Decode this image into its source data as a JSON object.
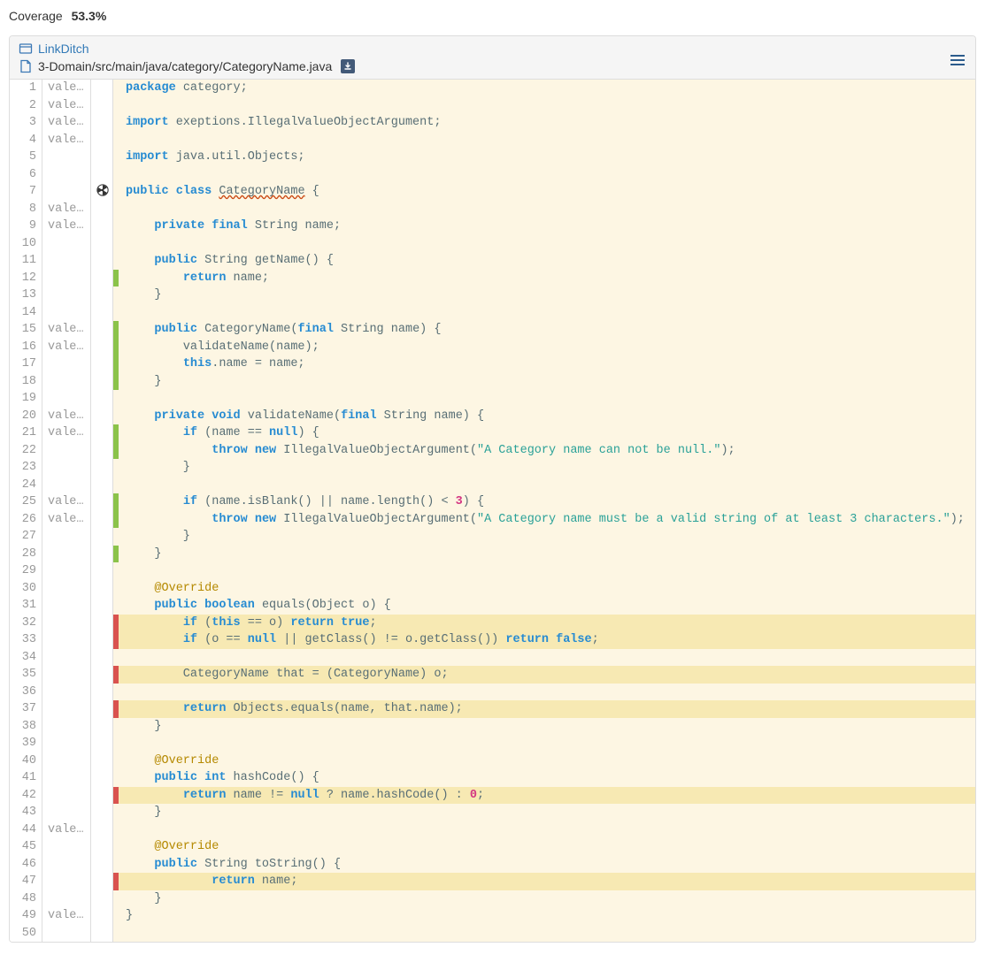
{
  "header": {
    "coverage_label": "Coverage",
    "coverage_value": "53.3%"
  },
  "breadcrumb": {
    "project_link": "LinkDitch",
    "file_path": "3-Domain/src/main/java/category/CategoryName.java"
  },
  "blame_text": "vale…",
  "lines": [
    {
      "n": 1,
      "blame": true,
      "icon": "",
      "cov": "none",
      "hl": false,
      "tokens": [
        [
          "kw",
          "package"
        ],
        [
          "plain",
          " category;"
        ]
      ]
    },
    {
      "n": 2,
      "blame": true,
      "icon": "",
      "cov": "none",
      "hl": false,
      "tokens": []
    },
    {
      "n": 3,
      "blame": true,
      "icon": "",
      "cov": "none",
      "hl": false,
      "tokens": [
        [
          "kw",
          "import"
        ],
        [
          "plain",
          " exeptions.IllegalValueObjectArgument;"
        ]
      ]
    },
    {
      "n": 4,
      "blame": true,
      "icon": "",
      "cov": "none",
      "hl": false,
      "tokens": []
    },
    {
      "n": 5,
      "blame": false,
      "icon": "",
      "cov": "none",
      "hl": false,
      "tokens": [
        [
          "kw",
          "import"
        ],
        [
          "plain",
          " java.util.Objects;"
        ]
      ]
    },
    {
      "n": 6,
      "blame": false,
      "icon": "",
      "cov": "none",
      "hl": false,
      "tokens": []
    },
    {
      "n": 7,
      "blame": false,
      "icon": "radiation",
      "cov": "none",
      "hl": false,
      "tokens": [
        [
          "kw",
          "public"
        ],
        [
          "plain",
          " "
        ],
        [
          "kw",
          "class"
        ],
        [
          "plain",
          " "
        ],
        [
          "def",
          "CategoryName"
        ],
        [
          "plain",
          " {"
        ]
      ]
    },
    {
      "n": 8,
      "blame": true,
      "icon": "",
      "cov": "none",
      "hl": false,
      "tokens": []
    },
    {
      "n": 9,
      "blame": true,
      "icon": "",
      "cov": "none",
      "hl": false,
      "tokens": [
        [
          "plain",
          "    "
        ],
        [
          "kw",
          "private"
        ],
        [
          "plain",
          " "
        ],
        [
          "kw",
          "final"
        ],
        [
          "plain",
          " String name;"
        ]
      ]
    },
    {
      "n": 10,
      "blame": false,
      "icon": "",
      "cov": "none",
      "hl": false,
      "tokens": []
    },
    {
      "n": 11,
      "blame": false,
      "icon": "",
      "cov": "none",
      "hl": false,
      "tokens": [
        [
          "plain",
          "    "
        ],
        [
          "kw",
          "public"
        ],
        [
          "plain",
          " String getName() {"
        ]
      ]
    },
    {
      "n": 12,
      "blame": false,
      "icon": "",
      "cov": "green",
      "hl": false,
      "tokens": [
        [
          "plain",
          "        "
        ],
        [
          "kw",
          "return"
        ],
        [
          "plain",
          " name;"
        ]
      ]
    },
    {
      "n": 13,
      "blame": false,
      "icon": "",
      "cov": "none",
      "hl": false,
      "tokens": [
        [
          "plain",
          "    }"
        ]
      ]
    },
    {
      "n": 14,
      "blame": false,
      "icon": "",
      "cov": "none",
      "hl": false,
      "tokens": []
    },
    {
      "n": 15,
      "blame": true,
      "icon": "",
      "cov": "green",
      "hl": false,
      "tokens": [
        [
          "plain",
          "    "
        ],
        [
          "kw",
          "public"
        ],
        [
          "plain",
          " CategoryName("
        ],
        [
          "kw",
          "final"
        ],
        [
          "plain",
          " String name) {"
        ]
      ]
    },
    {
      "n": 16,
      "blame": true,
      "icon": "",
      "cov": "green",
      "hl": false,
      "tokens": [
        [
          "plain",
          "        validateName(name);"
        ]
      ]
    },
    {
      "n": 17,
      "blame": false,
      "icon": "",
      "cov": "green",
      "hl": false,
      "tokens": [
        [
          "plain",
          "        "
        ],
        [
          "kw",
          "this"
        ],
        [
          "plain",
          ".name = name;"
        ]
      ]
    },
    {
      "n": 18,
      "blame": false,
      "icon": "",
      "cov": "green",
      "hl": false,
      "tokens": [
        [
          "plain",
          "    }"
        ]
      ]
    },
    {
      "n": 19,
      "blame": false,
      "icon": "",
      "cov": "none",
      "hl": false,
      "tokens": []
    },
    {
      "n": 20,
      "blame": true,
      "icon": "",
      "cov": "none",
      "hl": false,
      "tokens": [
        [
          "plain",
          "    "
        ],
        [
          "kw",
          "private"
        ],
        [
          "plain",
          " "
        ],
        [
          "kw",
          "void"
        ],
        [
          "plain",
          " validateName("
        ],
        [
          "kw",
          "final"
        ],
        [
          "plain",
          " String name) {"
        ]
      ]
    },
    {
      "n": 21,
      "blame": true,
      "icon": "",
      "cov": "green",
      "hl": false,
      "tokens": [
        [
          "plain",
          "        "
        ],
        [
          "kw",
          "if"
        ],
        [
          "plain",
          " (name == "
        ],
        [
          "kw",
          "null"
        ],
        [
          "plain",
          ") {"
        ]
      ]
    },
    {
      "n": 22,
      "blame": false,
      "icon": "",
      "cov": "green",
      "hl": false,
      "tokens": [
        [
          "plain",
          "            "
        ],
        [
          "kw",
          "throw"
        ],
        [
          "plain",
          " "
        ],
        [
          "kw",
          "new"
        ],
        [
          "plain",
          " IllegalValueObjectArgument("
        ],
        [
          "str",
          "\"A Category name can not be null.\""
        ],
        [
          "plain",
          ");"
        ]
      ]
    },
    {
      "n": 23,
      "blame": false,
      "icon": "",
      "cov": "none",
      "hl": false,
      "tokens": [
        [
          "plain",
          "        }"
        ]
      ]
    },
    {
      "n": 24,
      "blame": false,
      "icon": "",
      "cov": "none",
      "hl": false,
      "tokens": []
    },
    {
      "n": 25,
      "blame": true,
      "icon": "",
      "cov": "green",
      "hl": false,
      "tokens": [
        [
          "plain",
          "        "
        ],
        [
          "kw",
          "if"
        ],
        [
          "plain",
          " (name.isBlank() || name.length() < "
        ],
        [
          "num",
          "3"
        ],
        [
          "plain",
          ") {"
        ]
      ]
    },
    {
      "n": 26,
      "blame": true,
      "icon": "",
      "cov": "green",
      "hl": false,
      "tokens": [
        [
          "plain",
          "            "
        ],
        [
          "kw",
          "throw"
        ],
        [
          "plain",
          " "
        ],
        [
          "kw",
          "new"
        ],
        [
          "plain",
          " IllegalValueObjectArgument("
        ],
        [
          "str",
          "\"A Category name must be a valid string of at least 3 characters.\""
        ],
        [
          "plain",
          ");"
        ]
      ]
    },
    {
      "n": 27,
      "blame": false,
      "icon": "",
      "cov": "none",
      "hl": false,
      "tokens": [
        [
          "plain",
          "        }"
        ]
      ]
    },
    {
      "n": 28,
      "blame": false,
      "icon": "",
      "cov": "green",
      "hl": false,
      "tokens": [
        [
          "plain",
          "    }"
        ]
      ]
    },
    {
      "n": 29,
      "blame": false,
      "icon": "",
      "cov": "none",
      "hl": false,
      "tokens": []
    },
    {
      "n": 30,
      "blame": false,
      "icon": "",
      "cov": "none",
      "hl": false,
      "tokens": [
        [
          "plain",
          "    "
        ],
        [
          "ann",
          "@Override"
        ]
      ]
    },
    {
      "n": 31,
      "blame": false,
      "icon": "",
      "cov": "none",
      "hl": false,
      "tokens": [
        [
          "plain",
          "    "
        ],
        [
          "kw",
          "public"
        ],
        [
          "plain",
          " "
        ],
        [
          "kw",
          "boolean"
        ],
        [
          "plain",
          " equals(Object o) {"
        ]
      ]
    },
    {
      "n": 32,
      "blame": false,
      "icon": "",
      "cov": "red",
      "hl": true,
      "tokens": [
        [
          "plain",
          "        "
        ],
        [
          "kw",
          "if"
        ],
        [
          "plain",
          " ("
        ],
        [
          "kw",
          "this"
        ],
        [
          "plain",
          " == o) "
        ],
        [
          "kw",
          "return"
        ],
        [
          "plain",
          " "
        ],
        [
          "kw",
          "true"
        ],
        [
          "plain",
          ";"
        ]
      ]
    },
    {
      "n": 33,
      "blame": false,
      "icon": "",
      "cov": "red",
      "hl": true,
      "tokens": [
        [
          "plain",
          "        "
        ],
        [
          "kw",
          "if"
        ],
        [
          "plain",
          " (o == "
        ],
        [
          "kw",
          "null"
        ],
        [
          "plain",
          " || getClass() != o.getClass()) "
        ],
        [
          "kw",
          "return"
        ],
        [
          "plain",
          " "
        ],
        [
          "kw",
          "false"
        ],
        [
          "plain",
          ";"
        ]
      ]
    },
    {
      "n": 34,
      "blame": false,
      "icon": "",
      "cov": "none",
      "hl": false,
      "tokens": []
    },
    {
      "n": 35,
      "blame": false,
      "icon": "",
      "cov": "red",
      "hl": true,
      "tokens": [
        [
          "plain",
          "        CategoryName that = (CategoryName) o;"
        ]
      ]
    },
    {
      "n": 36,
      "blame": false,
      "icon": "",
      "cov": "none",
      "hl": false,
      "tokens": []
    },
    {
      "n": 37,
      "blame": false,
      "icon": "",
      "cov": "red",
      "hl": true,
      "tokens": [
        [
          "plain",
          "        "
        ],
        [
          "kw",
          "return"
        ],
        [
          "plain",
          " Objects.equals(name, that.name);"
        ]
      ]
    },
    {
      "n": 38,
      "blame": false,
      "icon": "",
      "cov": "none",
      "hl": false,
      "tokens": [
        [
          "plain",
          "    }"
        ]
      ]
    },
    {
      "n": 39,
      "blame": false,
      "icon": "",
      "cov": "none",
      "hl": false,
      "tokens": []
    },
    {
      "n": 40,
      "blame": false,
      "icon": "",
      "cov": "none",
      "hl": false,
      "tokens": [
        [
          "plain",
          "    "
        ],
        [
          "ann",
          "@Override"
        ]
      ]
    },
    {
      "n": 41,
      "blame": false,
      "icon": "",
      "cov": "none",
      "hl": false,
      "tokens": [
        [
          "plain",
          "    "
        ],
        [
          "kw",
          "public"
        ],
        [
          "plain",
          " "
        ],
        [
          "kw",
          "int"
        ],
        [
          "plain",
          " hashCode() {"
        ]
      ]
    },
    {
      "n": 42,
      "blame": false,
      "icon": "",
      "cov": "red",
      "hl": true,
      "tokens": [
        [
          "plain",
          "        "
        ],
        [
          "kw",
          "return"
        ],
        [
          "plain",
          " name != "
        ],
        [
          "kw",
          "null"
        ],
        [
          "plain",
          " ? name.hashCode() : "
        ],
        [
          "num",
          "0"
        ],
        [
          "plain",
          ";"
        ]
      ]
    },
    {
      "n": 43,
      "blame": false,
      "icon": "",
      "cov": "none",
      "hl": false,
      "tokens": [
        [
          "plain",
          "    }"
        ]
      ]
    },
    {
      "n": 44,
      "blame": true,
      "icon": "",
      "cov": "none",
      "hl": false,
      "tokens": []
    },
    {
      "n": 45,
      "blame": false,
      "icon": "",
      "cov": "none",
      "hl": false,
      "tokens": [
        [
          "plain",
          "    "
        ],
        [
          "ann",
          "@Override"
        ]
      ]
    },
    {
      "n": 46,
      "blame": false,
      "icon": "",
      "cov": "none",
      "hl": false,
      "tokens": [
        [
          "plain",
          "    "
        ],
        [
          "kw",
          "public"
        ],
        [
          "plain",
          " String toString() {"
        ]
      ]
    },
    {
      "n": 47,
      "blame": false,
      "icon": "",
      "cov": "red",
      "hl": true,
      "tokens": [
        [
          "plain",
          "            "
        ],
        [
          "kw",
          "return"
        ],
        [
          "plain",
          " name;"
        ]
      ]
    },
    {
      "n": 48,
      "blame": false,
      "icon": "",
      "cov": "none",
      "hl": false,
      "tokens": [
        [
          "plain",
          "    }"
        ]
      ]
    },
    {
      "n": 49,
      "blame": true,
      "icon": "",
      "cov": "none",
      "hl": false,
      "tokens": [
        [
          "plain",
          "}"
        ]
      ]
    },
    {
      "n": 50,
      "blame": false,
      "icon": "",
      "cov": "none",
      "hl": false,
      "tokens": []
    }
  ]
}
